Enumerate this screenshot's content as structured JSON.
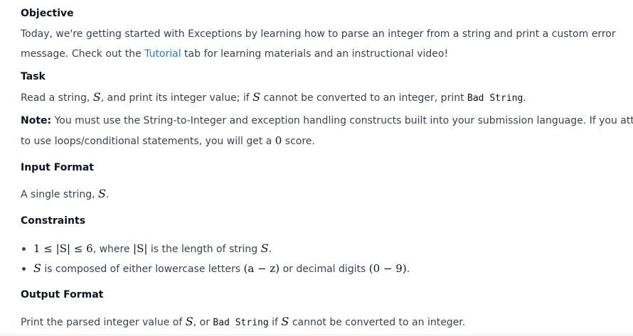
{
  "objective": {
    "heading": "Objective",
    "line1": "Today, we're getting started with Exceptions by learning how to parse an integer from a string and print a custom error",
    "line2_before": "message. Check out the ",
    "line2_link": "Tutorial",
    "line2_after": " tab for learning materials and an instructional video!"
  },
  "task": {
    "heading": "Task",
    "t1": "Read a string, ",
    "var_s": "S",
    "t2": ", and print its integer value; if ",
    "t3": " cannot be converted to an integer, print ",
    "code_bad": "Bad String",
    "t4": "."
  },
  "note": {
    "label": "Note:",
    "line1": " You must use the String-to-Integer and exception handling constructs built into your submission language. If you attempt",
    "line2_before": "to use loops/conditional statements, you will get a ",
    "zero": "0",
    "line2_after": " score."
  },
  "input_format": {
    "heading": "Input Format",
    "text_before": "A single string, ",
    "var": "S",
    "text_after": "."
  },
  "constraints": {
    "heading": "Constraints",
    "c1_math": "1 ≤ |S| ≤ 6",
    "c1_text": ", where ",
    "c1_math2": "|S|",
    "c1_text2": " is the length of string ",
    "c1_var": "S",
    "c1_end": ".",
    "c2_var": "S",
    "c2_text": " is composed of either lowercase letters ",
    "c2_math1": "(a − z)",
    "c2_text2": " or decimal digits ",
    "c2_math2": "(0 − 9)",
    "c2_end": "."
  },
  "output_format": {
    "heading": "Output Format",
    "t1": "Print the parsed integer value of ",
    "var": "S",
    "t2": ", or ",
    "code_bad": "Bad String",
    "t3": " if ",
    "t4": " cannot be converted to an integer."
  }
}
